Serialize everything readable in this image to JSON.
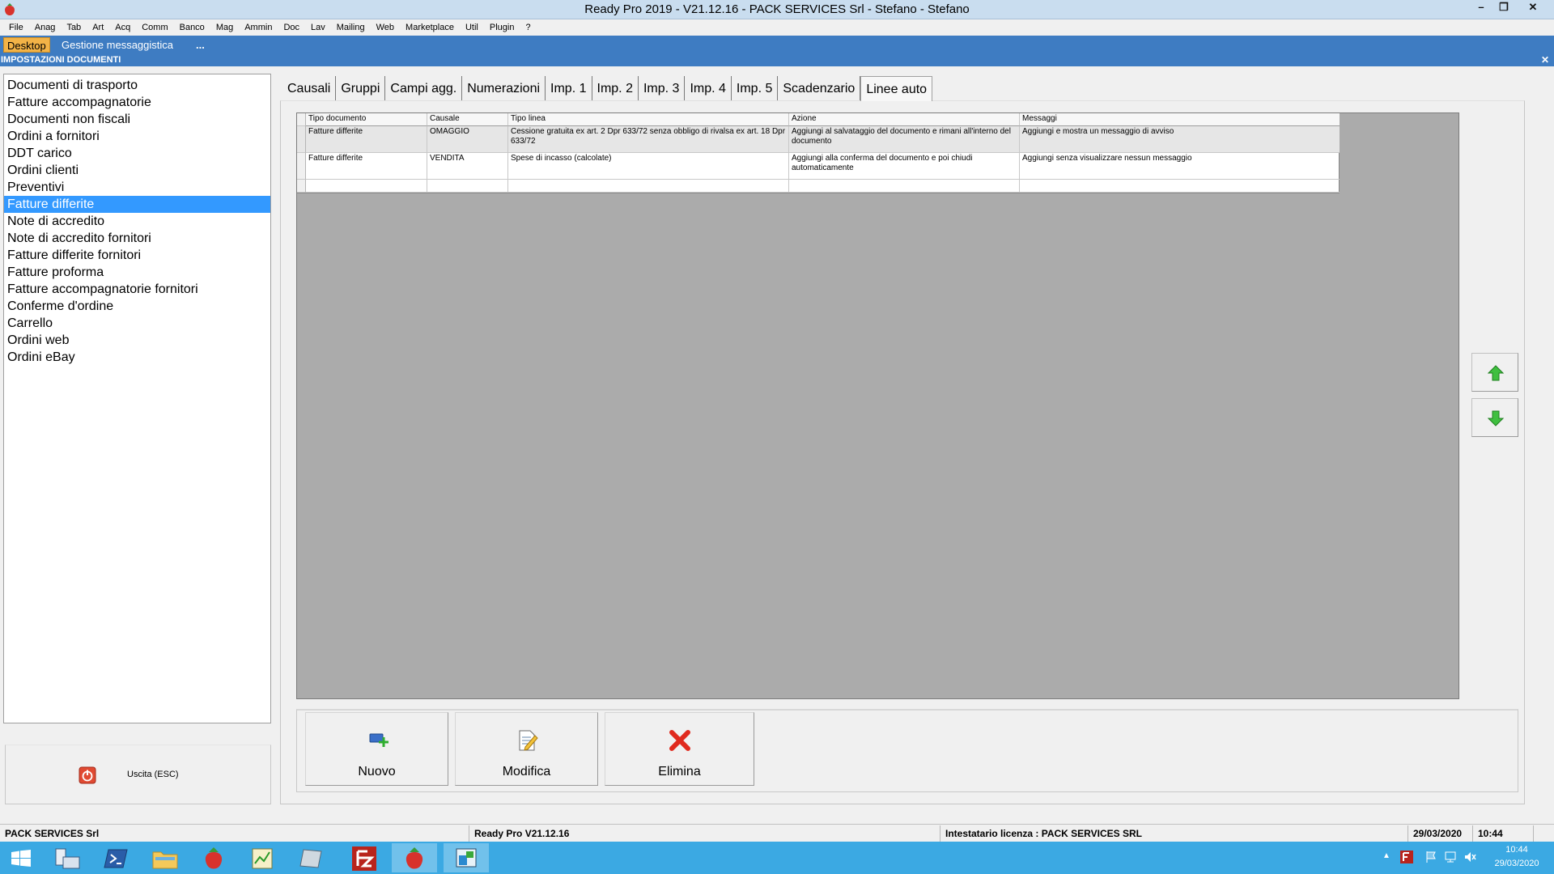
{
  "window": {
    "title": "Ready Pro 2019 - V21.12.16 - PACK SERVICES Srl - Stefano - Stefano"
  },
  "menu": [
    "File",
    "Anag",
    "Tab",
    "Art",
    "Acq",
    "Comm",
    "Banco",
    "Mag",
    "Ammin",
    "Doc",
    "Lav",
    "Mailing",
    "Web",
    "Marketplace",
    "Util",
    "Plugin",
    "?"
  ],
  "doc_tabs": {
    "desktop": "Desktop",
    "messaging": "Gestione messaggistica",
    "more": "..."
  },
  "panel_title": "IMPOSTAZIONI DOCUMENTI",
  "document_types": [
    "Documenti di trasporto",
    "Fatture accompagnatorie",
    "Documenti non fiscali",
    "Ordini a fornitori",
    "DDT carico",
    "Ordini clienti",
    "Preventivi",
    "Fatture differite",
    "Note di accredito",
    "Note di accredito fornitori",
    "Fatture differite fornitori",
    "Fatture proforma",
    "Fatture accompagnatorie fornitori",
    "Conferme d'ordine",
    "Carrello",
    "Ordini web",
    "Ordini eBay"
  ],
  "selected_document": "Fatture differite",
  "exit_button": "Uscita (ESC)",
  "tabs": [
    "Causali",
    "Gruppi",
    "Campi agg.",
    "Numerazioni",
    "Imp. 1",
    "Imp. 2",
    "Imp. 3",
    "Imp. 4",
    "Imp. 5",
    "Scadenzario",
    "Linee auto"
  ],
  "active_tab": "Linee auto",
  "table": {
    "headers": [
      "Tipo documento",
      "Causale",
      "Tipo linea",
      "Azione",
      "Messaggi"
    ],
    "rows": [
      [
        "Fatture differite",
        "OMAGGIO",
        "Cessione gratuita ex art. 2 Dpr 633/72 senza obbligo di rivalsa ex art. 18 Dpr 633/72",
        "Aggiungi al salvataggio del documento e rimani all'interno del documento",
        "Aggiungi e mostra un messaggio di avviso"
      ],
      [
        "Fatture differite",
        "VENDITA",
        "Spese di incasso (calcolate)",
        "Aggiungi alla conferma del documento e poi chiudi automaticamente",
        "Aggiungi senza visualizzare nessun messaggio"
      ]
    ]
  },
  "actions": {
    "new": "Nuovo",
    "edit": "Modifica",
    "delete": "Elimina"
  },
  "status": {
    "company": "PACK SERVICES Srl",
    "version": "Ready Pro V21.12.16",
    "license": "Intestatario licenza : PACK SERVICES SRL",
    "date": "29/03/2020",
    "time": "10:44"
  },
  "taskbar": {
    "clock_time": "10:44",
    "clock_date": "29/03/2020"
  },
  "colors": {
    "accent": "#3e7cc2",
    "selection": "#3399ff",
    "desktop_tab": "#f3b347",
    "taskbar": "#3ba9e3"
  }
}
